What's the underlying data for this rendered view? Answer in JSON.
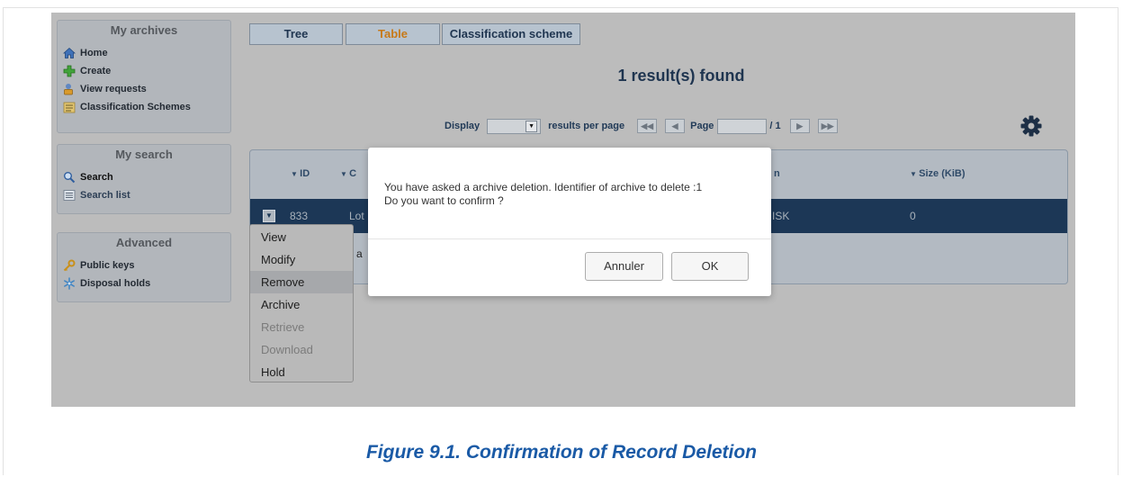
{
  "sidebar": {
    "my_archives": {
      "title": "My archives",
      "items": [
        {
          "label": "Home",
          "icon": "home-icon"
        },
        {
          "label": "Create",
          "icon": "plus-icon"
        },
        {
          "label": "View requests",
          "icon": "user-lock-icon"
        },
        {
          "label": "Classification Schemes",
          "icon": "folder-tree-icon"
        }
      ]
    },
    "my_search": {
      "title": "My search",
      "items": [
        {
          "label": "Search",
          "icon": "search-icon"
        },
        {
          "label": "Search list",
          "icon": "list-icon"
        }
      ]
    },
    "advanced": {
      "title": "Advanced",
      "items": [
        {
          "label": "Public keys",
          "icon": "key-icon"
        },
        {
          "label": "Disposal holds",
          "icon": "snowflake-icon"
        }
      ]
    }
  },
  "tabs": [
    {
      "label": "Tree",
      "active": false
    },
    {
      "label": "Table",
      "active": true
    },
    {
      "label": "Classification scheme",
      "active": false
    }
  ],
  "results": {
    "title": "1 result(s) found"
  },
  "pager": {
    "display_label": "Display",
    "per_page_label": "results per page",
    "page_label": "Page",
    "total": "/ 1"
  },
  "table": {
    "columns": [
      "ID",
      "C",
      "n",
      "Size (KiB)"
    ],
    "row": {
      "id": "833",
      "col2": "Lot",
      "col3": "ISK",
      "size": "0"
    },
    "under_text": "d a"
  },
  "context_menu": {
    "items": [
      {
        "label": "View",
        "state": "normal"
      },
      {
        "label": "Modify",
        "state": "normal"
      },
      {
        "label": "Remove",
        "state": "highlighted"
      },
      {
        "label": "Archive",
        "state": "normal"
      },
      {
        "label": "Retrieve",
        "state": "disabled"
      },
      {
        "label": "Download",
        "state": "disabled"
      },
      {
        "label": "Hold",
        "state": "normal"
      }
    ]
  },
  "modal": {
    "message_line1": "You have asked a archive deletion. Identifier of archive to delete :1",
    "message_line2": "Do you want to confirm ?",
    "cancel_label": "Annuler",
    "ok_label": "OK"
  },
  "caption": "Figure 9.1. Confirmation of Record Deletion",
  "colors": {
    "accent_active_tab": "#c77918",
    "selected_row": "#1c3756",
    "caption": "#1a5aa6"
  }
}
